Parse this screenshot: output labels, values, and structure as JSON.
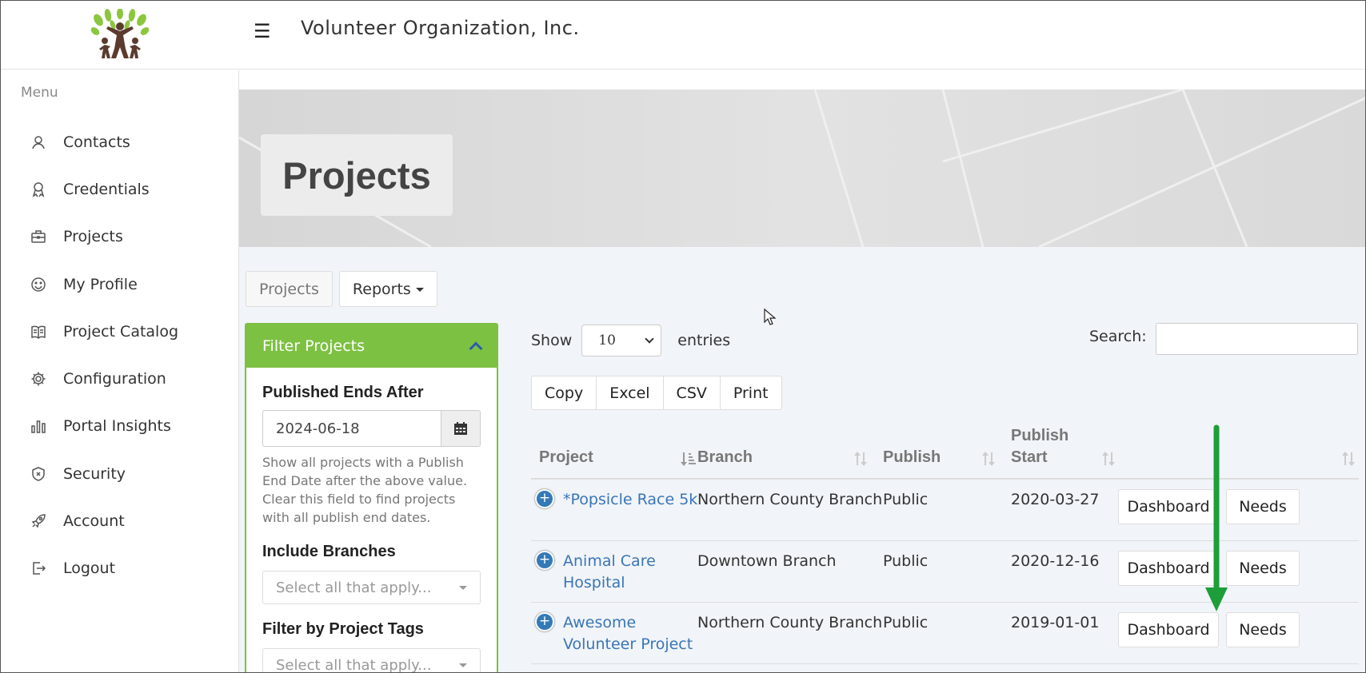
{
  "header": {
    "org_name": "Volunteer Organization, Inc."
  },
  "sidebar": {
    "menu_label": "Menu",
    "items": [
      {
        "label": "Contacts",
        "icon": "contacts-icon"
      },
      {
        "label": "Credentials",
        "icon": "award-icon"
      },
      {
        "label": "Projects",
        "icon": "briefcase-icon"
      },
      {
        "label": "My Profile",
        "icon": "smiley-icon"
      },
      {
        "label": "Project Catalog",
        "icon": "book-icon"
      },
      {
        "label": "Configuration",
        "icon": "gear-icon"
      },
      {
        "label": "Portal Insights",
        "icon": "bar-chart-icon"
      },
      {
        "label": "Security",
        "icon": "shield-icon"
      },
      {
        "label": "Account",
        "icon": "rocket-icon"
      },
      {
        "label": "Logout",
        "icon": "logout-icon"
      }
    ]
  },
  "page": {
    "title": "Projects"
  },
  "tabs": {
    "projects": "Projects",
    "reports": "Reports"
  },
  "filter": {
    "heading": "Filter Projects",
    "published_ends_label": "Published Ends After",
    "published_ends_value": "2024-06-18",
    "help_text": "Show all projects with a Publish End Date after the above value. Clear this field to find projects with all publish end dates.",
    "branches_label": "Include Branches",
    "branches_placeholder": "Select all that apply...",
    "tags_label": "Filter by Project Tags",
    "tags_placeholder": "Select all that apply..."
  },
  "table_controls": {
    "show_label": "Show",
    "entries_value": "10",
    "entries_label": "entries",
    "search_label": "Search:",
    "export_buttons": [
      "Copy",
      "Excel",
      "CSV",
      "Print"
    ]
  },
  "table": {
    "headers": {
      "project": "Project",
      "branch": "Branch",
      "publish": "Publish",
      "publish_start": "Publish Start"
    },
    "rows": [
      {
        "project": "*Popsicle Race 5k",
        "branch": "Northern County Branch",
        "publish": "Public",
        "publish_start": "2020-03-27",
        "dashboard": "Dashboard",
        "needs": "Needs"
      },
      {
        "project": "Animal Care Hospital",
        "branch": "Downtown Branch",
        "publish": "Public",
        "publish_start": "2020-12-16",
        "dashboard": "Dashboard",
        "needs": "Needs"
      },
      {
        "project": "Awesome Volunteer Project",
        "branch": "Northern County Branch",
        "publish": "Public",
        "publish_start": "2019-01-01",
        "dashboard": "Dashboard",
        "needs": "Needs"
      }
    ]
  },
  "colors": {
    "filter_green": "#7dc143",
    "link_blue": "#3a76b5",
    "arrow_green": "#1e9e3a"
  }
}
